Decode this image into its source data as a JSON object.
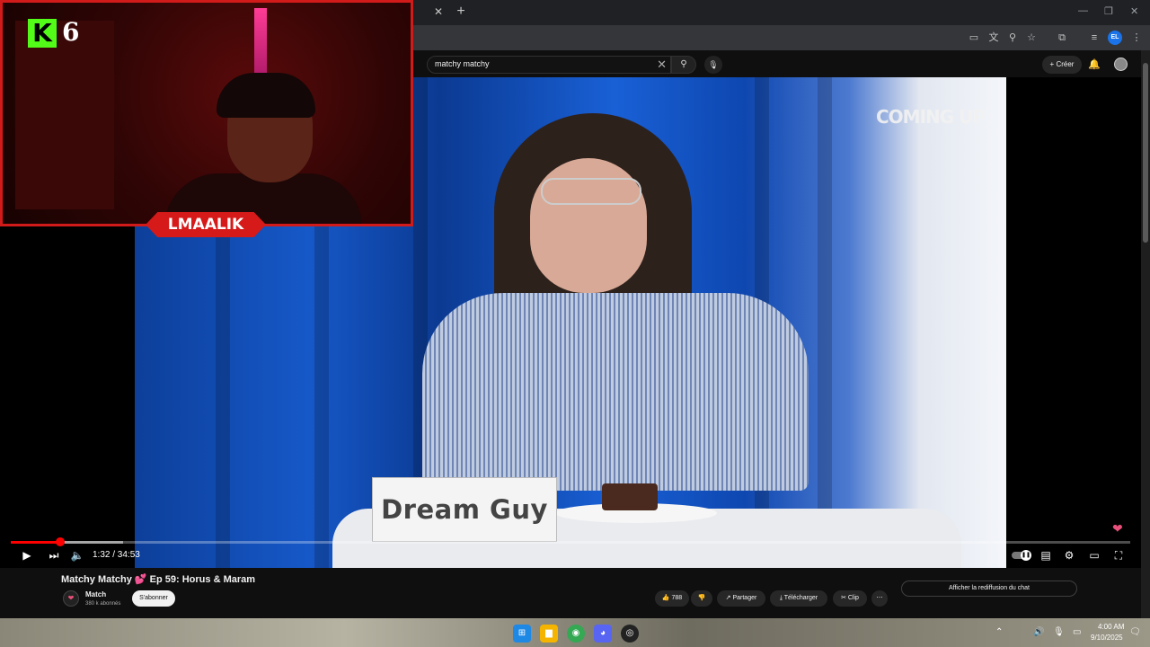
{
  "browser": {
    "close_tab": "✕",
    "new_tab": "+",
    "profile_initials": "EL",
    "window_controls": [
      "—",
      "❐",
      "✕"
    ]
  },
  "youtube": {
    "search": {
      "query": "matchy matchy"
    },
    "create_label": "Créer"
  },
  "video": {
    "overlay_text": "COMING UP",
    "name_card": "Dream Guy",
    "progress_fraction": 0.0441,
    "buffered_fraction": 0.1
  },
  "stream_overlay": {
    "streamer_name": "LMAALIK",
    "kick_logo": "K",
    "number": "6"
  },
  "player": {
    "time": "1:32 / 34:53"
  },
  "below_video": {
    "title": "Matchy Matchy 💕 Ep 59: Horus & Maram",
    "channel_name": "Match",
    "subscribers": "380 k abonnés",
    "subscribe_label": "S'abonner",
    "likes": "788",
    "share_label": "Partager",
    "download_label": "Télécharger",
    "clip_label": "Clip",
    "more_label": "⋯",
    "chat_replay_label": "Afficher la rediffusion du chat"
  },
  "taskbar": {
    "time": "4:00 AM",
    "date": "9/10/2025"
  },
  "colors": {
    "yt_red": "#ff0000",
    "kick_green": "#53fc18",
    "overlay_red": "#d61a1a"
  }
}
